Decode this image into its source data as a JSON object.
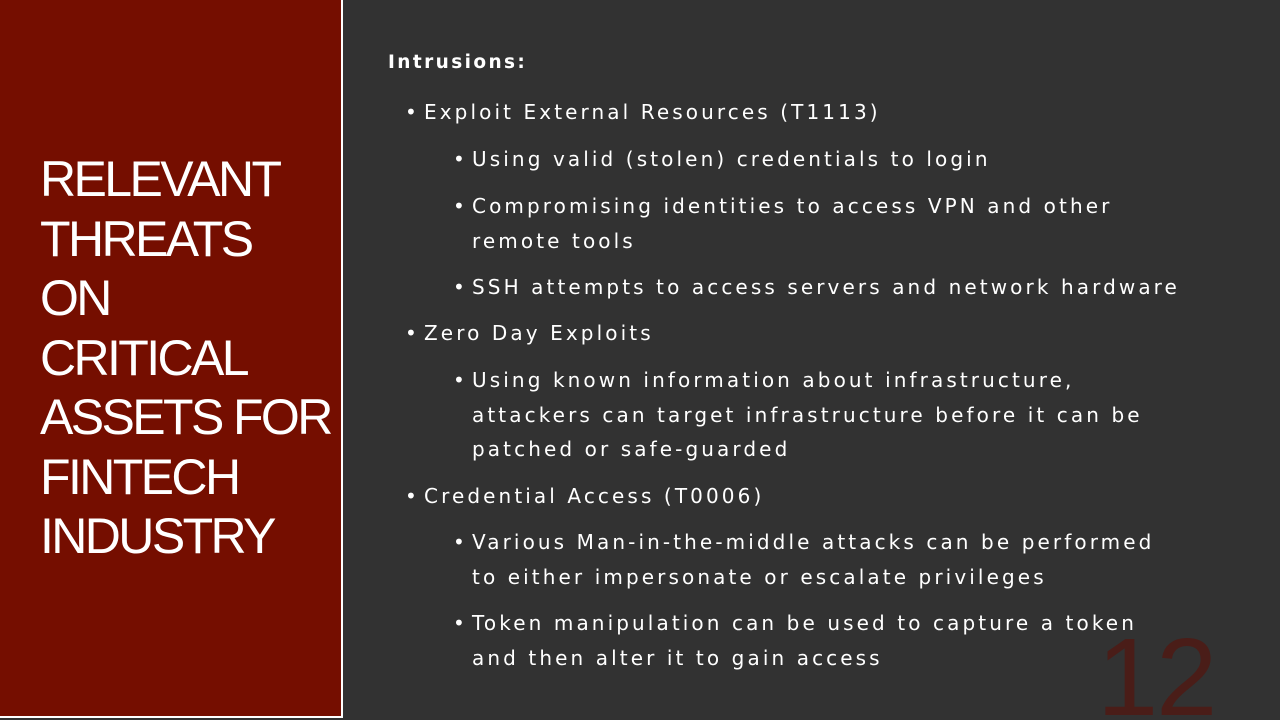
{
  "title_lines": [
    "RELEVANT",
    "THREATS",
    "ON",
    "CRITICAL",
    "ASSETS FOR",
    "FINTECH",
    "INDUSTRY"
  ],
  "heading": "Intrusions:",
  "bullet_glyph": "•",
  "items": [
    {
      "lines": [
        "Exploit External Resources (T1113)"
      ]
    },
    {
      "lines": [
        "Using valid (stolen) credentials to login"
      ]
    },
    {
      "lines": [
        "Compromising identities to access VPN and other",
        "remote tools"
      ]
    },
    {
      "lines": [
        "SSH attempts to access servers and network hardware"
      ]
    },
    {
      "lines": [
        "Zero Day Exploits"
      ]
    },
    {
      "lines": [
        "Using known information about infrastructure,",
        "attackers can target infrastructure before it can be",
        "patched or safe-guarded"
      ]
    },
    {
      "lines": [
        "Credential Access (T0006)"
      ]
    },
    {
      "lines": [
        "Various Man-in-the-middle attacks can be performed",
        "to either impersonate or escalate privileges"
      ]
    },
    {
      "lines": [
        "Token manipulation can be used to capture a token",
        "and then alter it to gain access"
      ]
    }
  ],
  "page_number": "12",
  "colors": {
    "title_panel": "#750E00",
    "content_background": "#323232",
    "text": "#FFFFFF",
    "page_number": "#4A1D18"
  }
}
